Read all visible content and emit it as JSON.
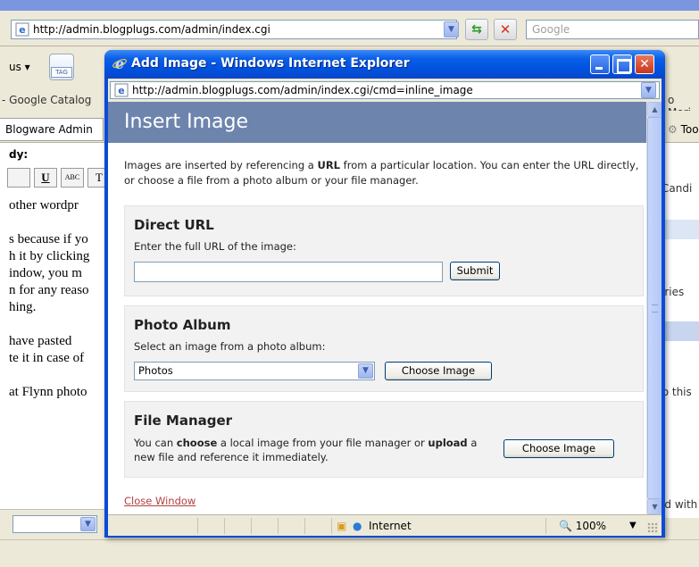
{
  "background_browser": {
    "address_url": "http://admin.blogplugs.com/admin/index.cgi",
    "search_placeholder": "Google",
    "toolbar_left": "us ▾",
    "tag_label": "TAG",
    "bookmark_left": "- Google Catalog",
    "bookmark_right": "o Mori",
    "tab_label": "Blogware Admin",
    "tools_label": "Too",
    "content_lines": [
      "dy:",
      "",
      "",
      "other wordpr",
      "",
      "s because if yo",
      "h it by clicking",
      "indow, you m",
      "n for any reaso",
      "hing.",
      "",
      "have pasted",
      "te it in case of",
      "",
      "at Flynn photo"
    ],
    "format_buttons": [
      "",
      "U",
      "ABC",
      "T"
    ],
    "right_pane": {
      "path": "/Candi",
      "categories": "ories",
      "to_this": "to this",
      "edited": "ed with"
    },
    "bottom_select_value": ""
  },
  "popup": {
    "window_title": "Add Image - Windows Internet Explorer",
    "address_url": "http://admin.blogplugs.com/admin/index.cgi/cmd=inline_image",
    "header_title": "Insert Image",
    "intro_parts": [
      "Images are inserted by referencing a ",
      "URL",
      " from a particular location. You can enter the URL directly, or choose a file from a photo album or your file manager."
    ],
    "direct_url": {
      "title": "Direct URL",
      "subtitle": "Enter the full URL of the image:",
      "input_value": "",
      "submit_label": "Submit"
    },
    "photo_album": {
      "title": "Photo Album",
      "subtitle": "Select an image from a photo album:",
      "select_value": "Photos",
      "button_label": "Choose Image"
    },
    "file_manager": {
      "title": "File Manager",
      "desc_parts": [
        "You can ",
        "choose",
        " a local image from your file manager or ",
        "upload",
        " a new file and reference it immediately."
      ],
      "button_label": "Choose Image"
    },
    "close_link": "Close Window",
    "status": {
      "zone": "Internet",
      "zoom": "100%"
    }
  },
  "colors": {
    "header_bar": "#6d84ad",
    "xp_title_blue": "#0050dd",
    "link_red": "#b04040"
  }
}
